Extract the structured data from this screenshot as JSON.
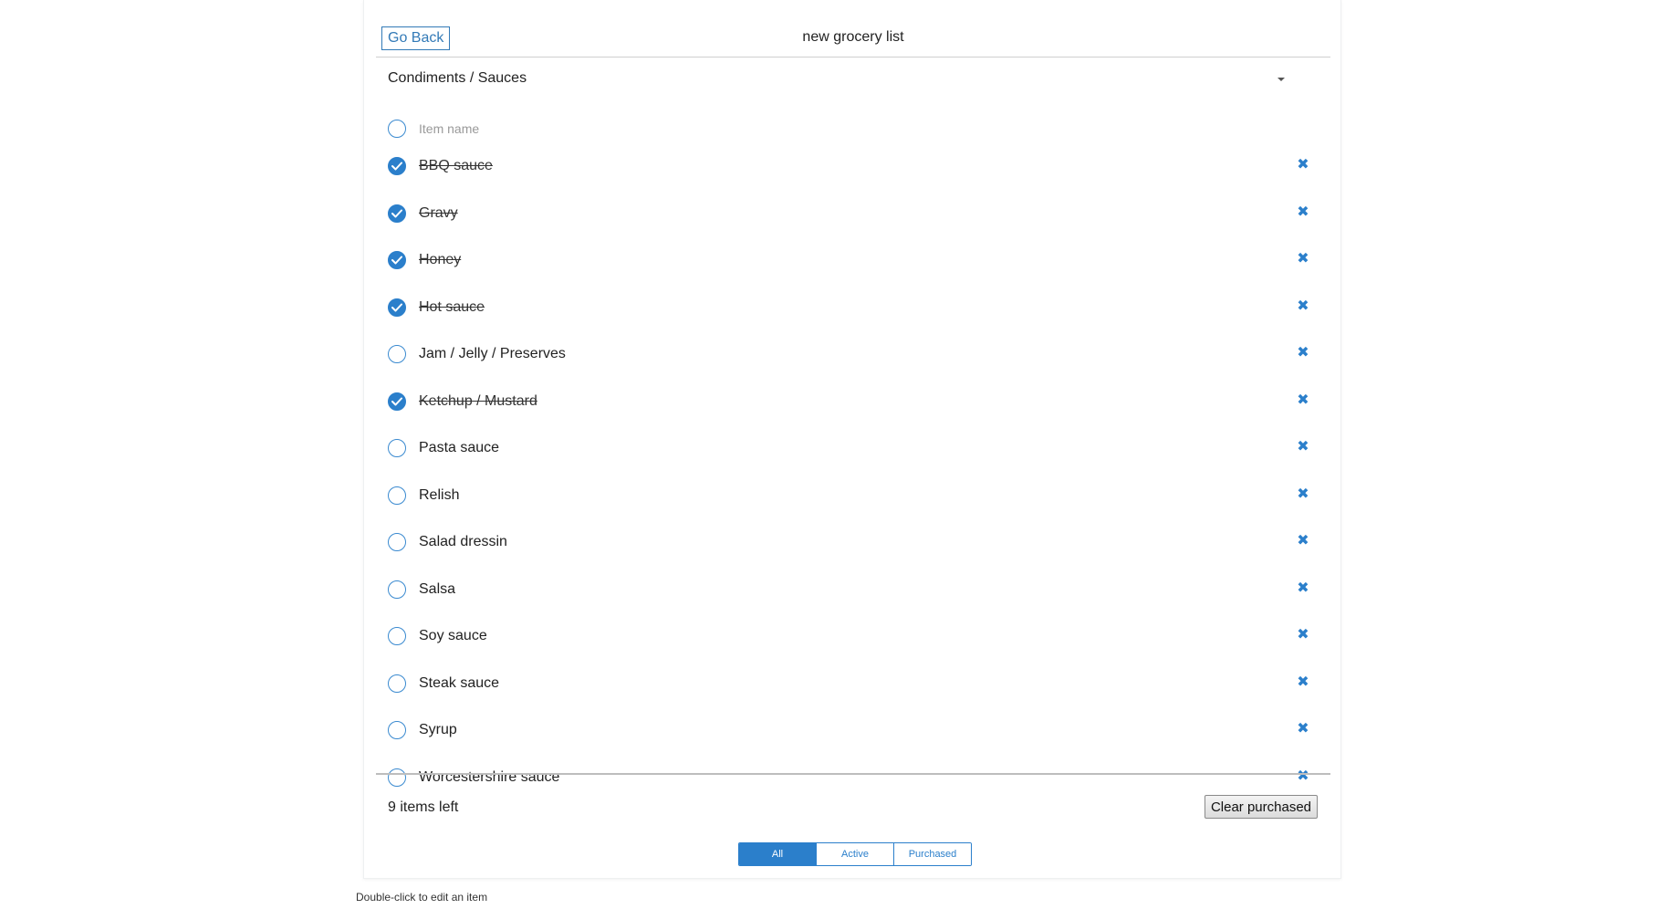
{
  "header": {
    "back_label": "Go Back",
    "list_title": "new grocery list"
  },
  "category": {
    "label": "Condiments / Sauces"
  },
  "new_item": {
    "placeholder": "Item name"
  },
  "items": [
    {
      "label": "BBQ sauce",
      "purchased": true
    },
    {
      "label": "Gravy",
      "purchased": true
    },
    {
      "label": "Honey",
      "purchased": true
    },
    {
      "label": "Hot sauce",
      "purchased": true
    },
    {
      "label": "Jam / Jelly / Preserves",
      "purchased": false
    },
    {
      "label": "Ketchup / Mustard",
      "purchased": true
    },
    {
      "label": "Pasta sauce",
      "purchased": false
    },
    {
      "label": "Relish",
      "purchased": false
    },
    {
      "label": "Salad dressin",
      "purchased": false
    },
    {
      "label": "Salsa",
      "purchased": false
    },
    {
      "label": "Soy sauce",
      "purchased": false
    },
    {
      "label": "Steak sauce",
      "purchased": false
    },
    {
      "label": "Syrup",
      "purchased": false
    },
    {
      "label": "Worcestershire sauce",
      "purchased": false
    }
  ],
  "footer": {
    "items_left": "9 items left",
    "clear_label": "Clear purchased"
  },
  "filters": {
    "all": "All",
    "active": "Active",
    "purchased": "Purchased",
    "selected": "All"
  },
  "hint": "Double-click to edit an item",
  "colors": {
    "accent": "#2b7fcb",
    "divider": "#cfcfcf"
  },
  "icons": {
    "check": "check-icon",
    "delete": "close-icon",
    "dropdown": "caret-down-icon"
  }
}
